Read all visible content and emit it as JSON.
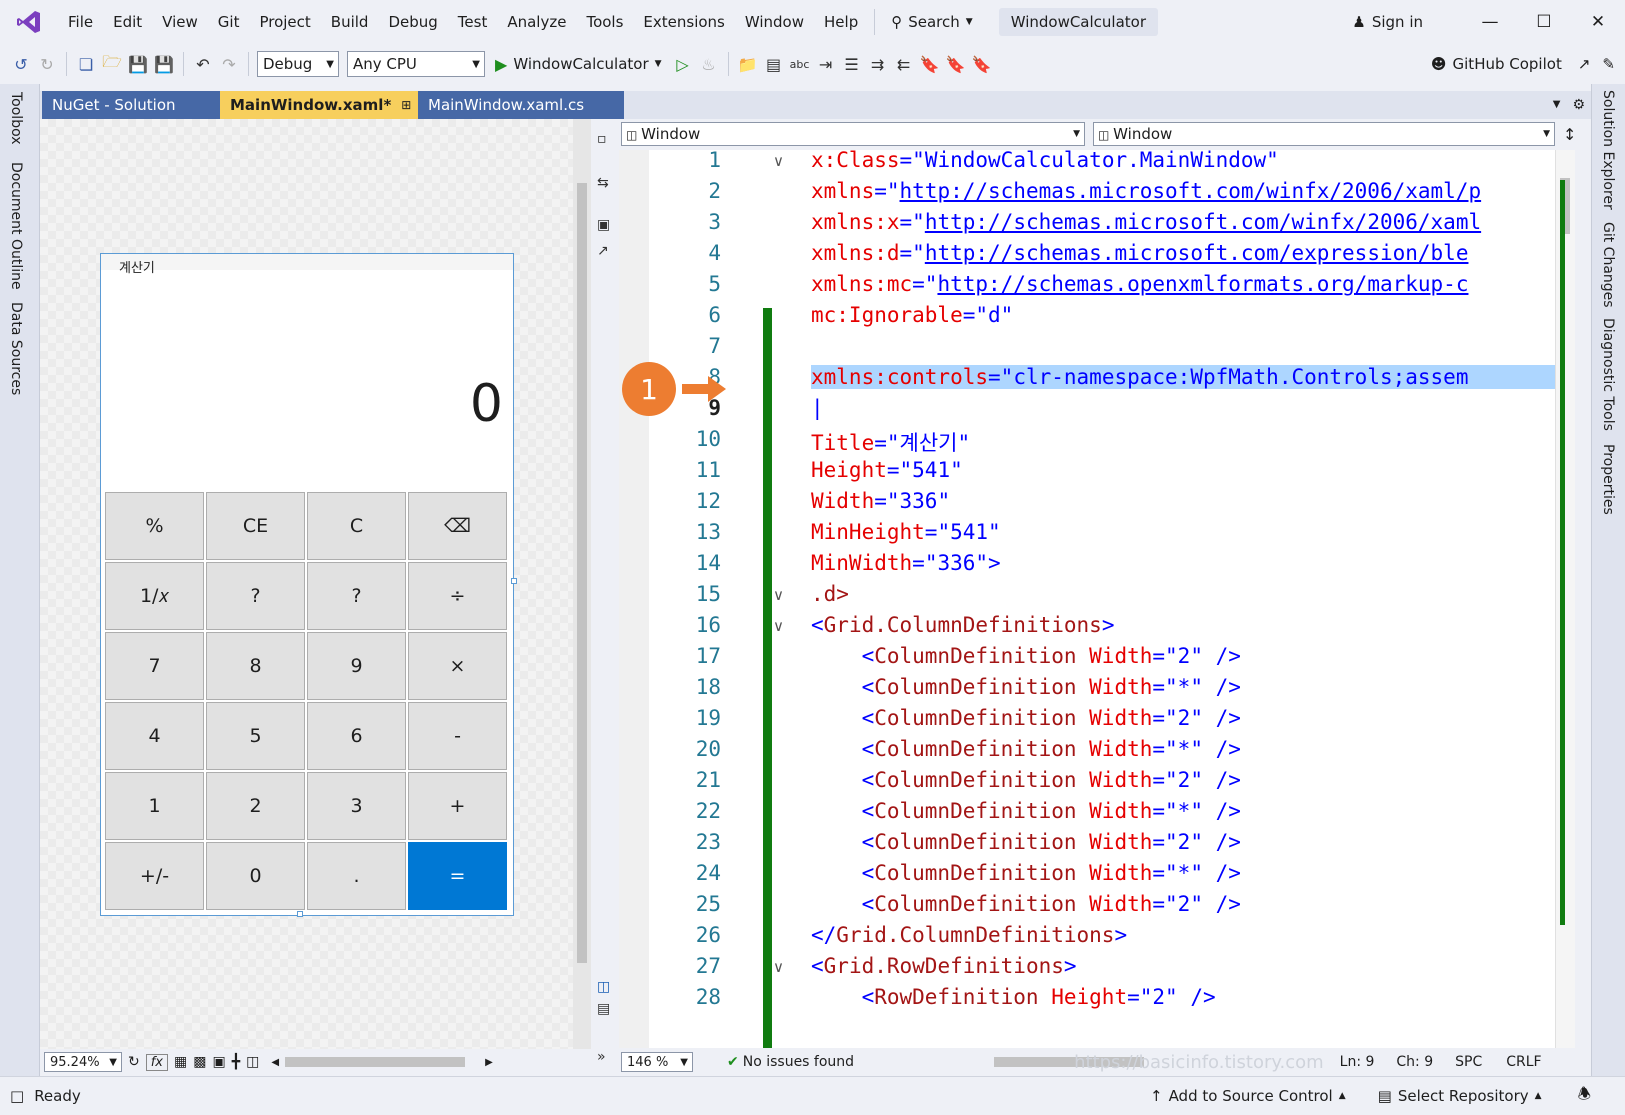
{
  "menu": [
    "File",
    "Edit",
    "View",
    "Git",
    "Project",
    "Build",
    "Debug",
    "Test",
    "Analyze",
    "Tools",
    "Extensions",
    "Window",
    "Help"
  ],
  "search_label": "Search",
  "solution_title": "WindowCalculator",
  "sign_in": "Sign in",
  "toolbar": {
    "config": "Debug",
    "platform": "Any CPU",
    "run_target": "WindowCalculator",
    "copilot": "GitHub Copilot"
  },
  "left_tabs": [
    "Toolbox",
    "Document Outline",
    "Data Sources"
  ],
  "right_tabs": [
    "Solution Explorer",
    "Git Changes",
    "Diagnostic Tools",
    "Properties"
  ],
  "doc_tabs": [
    {
      "label": "NuGet - Solution"
    },
    {
      "label": "MainWindow.xaml*"
    },
    {
      "label": "MainWindow.xaml.cs"
    }
  ],
  "calculator": {
    "title": "계산기",
    "display": "0",
    "keys": [
      "%",
      "CE",
      "C",
      "⌫",
      "1/𝑥",
      "?",
      "?",
      "÷",
      "7",
      "8",
      "9",
      "×",
      "4",
      "5",
      "6",
      "-",
      "1",
      "2",
      "3",
      "+",
      "+/-",
      "0",
      ".",
      "="
    ]
  },
  "designer_zoom": "95.24%",
  "designer_fx": "fx",
  "nav": {
    "left": "Window",
    "right": "Window"
  },
  "editor_zoom": "146 %",
  "issues": "No issues found",
  "cursor": {
    "ln": "Ln: 9",
    "ch": "Ch: 9",
    "ws": "SPC",
    "eol": "CRLF"
  },
  "annotation_number": "1",
  "watermark": "https://basicinfo.tistory.com",
  "status": {
    "ready": "Ready",
    "source_control": "Add to Source Control",
    "repo": "Select Repository"
  },
  "code_lines": [
    {
      "n": "1",
      "fold": true,
      "segs": [
        [
          "a",
          "x:Class"
        ],
        [
          "p",
          "="
        ],
        [
          "v",
          "\"WindowCalculator.MainWindow\""
        ]
      ]
    },
    {
      "n": "2",
      "segs": [
        [
          "a",
          "xmlns"
        ],
        [
          "p",
          "=\""
        ],
        [
          "u",
          "http://schemas.microsoft.com/winfx/2006/xaml/p"
        ]
      ]
    },
    {
      "n": "3",
      "segs": [
        [
          "a",
          "xmlns:x"
        ],
        [
          "p",
          "=\""
        ],
        [
          "u",
          "http://schemas.microsoft.com/winfx/2006/xaml"
        ]
      ]
    },
    {
      "n": "4",
      "segs": [
        [
          "a",
          "xmlns:d"
        ],
        [
          "p",
          "=\""
        ],
        [
          "u",
          "http://schemas.microsoft.com/expression/ble"
        ]
      ]
    },
    {
      "n": "5",
      "segs": [
        [
          "a",
          "xmlns:mc"
        ],
        [
          "p",
          "=\""
        ],
        [
          "u",
          "http://schemas.openxmlformats.org/markup-c"
        ]
      ]
    },
    {
      "n": "6",
      "segs": [
        [
          "a",
          "mc:Ignorable"
        ],
        [
          "p",
          "="
        ],
        [
          "v",
          "\"d\""
        ]
      ]
    },
    {
      "n": "7",
      "segs": []
    },
    {
      "n": "8",
      "hl": true,
      "segs": [
        [
          "a",
          "xmlns:controls"
        ],
        [
          "p",
          "="
        ],
        [
          "v",
          "\"clr-namespace:WpfMath.Controls;assem"
        ]
      ]
    },
    {
      "n": "9",
      "cur": true,
      "segs": [
        [
          "p",
          "|"
        ]
      ]
    },
    {
      "n": "10",
      "segs": [
        [
          "a",
          "Title"
        ],
        [
          "p",
          "="
        ],
        [
          "v",
          "\"계산기\""
        ]
      ]
    },
    {
      "n": "11",
      "segs": [
        [
          "a",
          "Height"
        ],
        [
          "p",
          "="
        ],
        [
          "v",
          "\"541\""
        ]
      ]
    },
    {
      "n": "12",
      "segs": [
        [
          "a",
          "Width"
        ],
        [
          "p",
          "="
        ],
        [
          "v",
          "\"336\""
        ]
      ]
    },
    {
      "n": "13",
      "segs": [
        [
          "a",
          "MinHeight"
        ],
        [
          "p",
          "="
        ],
        [
          "v",
          "\"541\""
        ]
      ]
    },
    {
      "n": "14",
      "segs": [
        [
          "a",
          "MinWidth"
        ],
        [
          "p",
          "="
        ],
        [
          "v",
          "\"336\">"
        ]
      ]
    },
    {
      "n": "15",
      "fold": true,
      "segs": [
        [
          "t",
          ".d>"
        ]
      ]
    },
    {
      "n": "16",
      "fold": true,
      "segs": [
        [
          "p",
          "<"
        ],
        [
          "t",
          "Grid.ColumnDefinitions"
        ],
        [
          "p",
          ">"
        ]
      ]
    },
    {
      "n": "17",
      "segs": [
        [
          "p",
          "    <"
        ],
        [
          "t",
          "ColumnDefinition "
        ],
        [
          "a",
          "Width"
        ],
        [
          "p",
          "="
        ],
        [
          "v",
          "\"2\""
        ],
        [
          "p",
          " />"
        ]
      ]
    },
    {
      "n": "18",
      "segs": [
        [
          "p",
          "    <"
        ],
        [
          "t",
          "ColumnDefinition "
        ],
        [
          "a",
          "Width"
        ],
        [
          "p",
          "="
        ],
        [
          "v",
          "\"*\""
        ],
        [
          "p",
          " />"
        ]
      ]
    },
    {
      "n": "19",
      "segs": [
        [
          "p",
          "    <"
        ],
        [
          "t",
          "ColumnDefinition "
        ],
        [
          "a",
          "Width"
        ],
        [
          "p",
          "="
        ],
        [
          "v",
          "\"2\""
        ],
        [
          "p",
          " />"
        ]
      ]
    },
    {
      "n": "20",
      "segs": [
        [
          "p",
          "    <"
        ],
        [
          "t",
          "ColumnDefinition "
        ],
        [
          "a",
          "Width"
        ],
        [
          "p",
          "="
        ],
        [
          "v",
          "\"*\""
        ],
        [
          "p",
          " />"
        ]
      ]
    },
    {
      "n": "21",
      "segs": [
        [
          "p",
          "    <"
        ],
        [
          "t",
          "ColumnDefinition "
        ],
        [
          "a",
          "Width"
        ],
        [
          "p",
          "="
        ],
        [
          "v",
          "\"2\""
        ],
        [
          "p",
          " />"
        ]
      ]
    },
    {
      "n": "22",
      "segs": [
        [
          "p",
          "    <"
        ],
        [
          "t",
          "ColumnDefinition "
        ],
        [
          "a",
          "Width"
        ],
        [
          "p",
          "="
        ],
        [
          "v",
          "\"*\""
        ],
        [
          "p",
          " />"
        ]
      ]
    },
    {
      "n": "23",
      "segs": [
        [
          "p",
          "    <"
        ],
        [
          "t",
          "ColumnDefinition "
        ],
        [
          "a",
          "Width"
        ],
        [
          "p",
          "="
        ],
        [
          "v",
          "\"2\""
        ],
        [
          "p",
          " />"
        ]
      ]
    },
    {
      "n": "24",
      "segs": [
        [
          "p",
          "    <"
        ],
        [
          "t",
          "ColumnDefinition "
        ],
        [
          "a",
          "Width"
        ],
        [
          "p",
          "="
        ],
        [
          "v",
          "\"*\""
        ],
        [
          "p",
          " />"
        ]
      ]
    },
    {
      "n": "25",
      "segs": [
        [
          "p",
          "    <"
        ],
        [
          "t",
          "ColumnDefinition "
        ],
        [
          "a",
          "Width"
        ],
        [
          "p",
          "="
        ],
        [
          "v",
          "\"2\""
        ],
        [
          "p",
          " />"
        ]
      ]
    },
    {
      "n": "26",
      "segs": [
        [
          "p",
          "</"
        ],
        [
          "t",
          "Grid.ColumnDefinitions"
        ],
        [
          "p",
          ">"
        ]
      ]
    },
    {
      "n": "27",
      "fold": true,
      "segs": [
        [
          "p",
          "<"
        ],
        [
          "t",
          "Grid.RowDefinitions"
        ],
        [
          "p",
          ">"
        ]
      ]
    },
    {
      "n": "28",
      "segs": [
        [
          "p",
          "    <"
        ],
        [
          "t",
          "RowDefinition "
        ],
        [
          "a",
          "Height"
        ],
        [
          "p",
          "="
        ],
        [
          "v",
          "\"2\""
        ],
        [
          "p",
          " />"
        ]
      ]
    }
  ]
}
